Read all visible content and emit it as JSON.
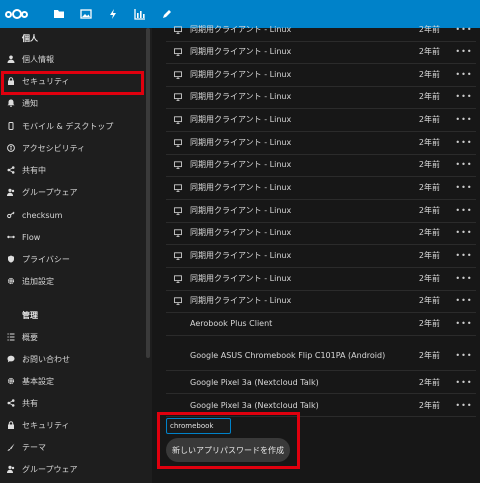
{
  "header": {
    "apps": [
      {
        "icon": "folder-icon",
        "label": "Files"
      },
      {
        "icon": "image-icon",
        "label": "Photos"
      },
      {
        "icon": "lightning-icon",
        "label": "Activity"
      },
      {
        "icon": "chart-icon",
        "label": "Dashboard"
      },
      {
        "icon": "pencil-icon",
        "label": "Notes"
      }
    ]
  },
  "sidebar": {
    "personal_title": "個人",
    "personal_items": [
      {
        "icon": "user-icon",
        "label": "個人情報"
      },
      {
        "icon": "lock-icon",
        "label": "セキュリティ"
      },
      {
        "icon": "bell-icon",
        "label": "通知"
      },
      {
        "icon": "phone-icon",
        "label": "モバイル & デスクトップ"
      },
      {
        "icon": "person-circle-icon",
        "label": "アクセシビリティ"
      },
      {
        "icon": "share-icon",
        "label": "共有中"
      },
      {
        "icon": "group-icon",
        "label": "グループウェア"
      },
      {
        "icon": "key-icon",
        "label": "checksum"
      },
      {
        "icon": "flow-icon",
        "label": "Flow"
      },
      {
        "icon": "privacy-icon",
        "label": "プライバシー"
      },
      {
        "icon": "gear-icon",
        "label": "追加設定"
      }
    ],
    "admin_title": "管理",
    "admin_items": [
      {
        "icon": "list-icon",
        "label": "概要"
      },
      {
        "icon": "chat-icon",
        "label": "お問い合わせ"
      },
      {
        "icon": "gear-icon",
        "label": "基本設定"
      },
      {
        "icon": "share-icon",
        "label": "共有"
      },
      {
        "icon": "lock-icon",
        "label": "セキュリティ"
      },
      {
        "icon": "brush-icon",
        "label": "テーマ"
      },
      {
        "icon": "group-icon",
        "label": "グループウェア"
      }
    ]
  },
  "sessions": [
    {
      "name": "同期用クライアント - Linux",
      "age": "2年前",
      "desktop": true
    },
    {
      "name": "同期用クライアント - Linux",
      "age": "2年前",
      "desktop": true
    },
    {
      "name": "同期用クライアント - Linux",
      "age": "2年前",
      "desktop": true
    },
    {
      "name": "同期用クライアント - Linux",
      "age": "2年前",
      "desktop": true
    },
    {
      "name": "同期用クライアント - Linux",
      "age": "2年前",
      "desktop": true
    },
    {
      "name": "同期用クライアント - Linux",
      "age": "2年前",
      "desktop": true
    },
    {
      "name": "同期用クライアント - Linux",
      "age": "2年前",
      "desktop": true
    },
    {
      "name": "同期用クライアント - Linux",
      "age": "2年前",
      "desktop": true
    },
    {
      "name": "同期用クライアント - Linux",
      "age": "2年前",
      "desktop": true
    },
    {
      "name": "同期用クライアント - Linux",
      "age": "2年前",
      "desktop": true
    },
    {
      "name": "同期用クライアント - Linux",
      "age": "2年前",
      "desktop": true
    },
    {
      "name": "同期用クライアント - Linux",
      "age": "2年前",
      "desktop": true
    },
    {
      "name": "同期用クライアント - Linux",
      "age": "2年前",
      "desktop": true
    },
    {
      "name": "Aerobook Plus Client",
      "age": "2年前",
      "desktop": false
    },
    {
      "name": "Google ASUS Chromebook Flip C101PA (Android)",
      "age": "2年前",
      "desktop": false
    },
    {
      "name": "Google Pixel 3a (Nextcloud Talk)",
      "age": "2年前",
      "desktop": false
    },
    {
      "name": "Google Pixel 3a (Nextcloud Talk)",
      "age": "2年前",
      "desktop": false
    }
  ],
  "more_label": "•••",
  "new_password": {
    "value": "chromebook",
    "button_label": "新しいアプリパスワードを作成"
  },
  "colors": {
    "accent": "#0082c9",
    "highlight": "#e0000e"
  }
}
